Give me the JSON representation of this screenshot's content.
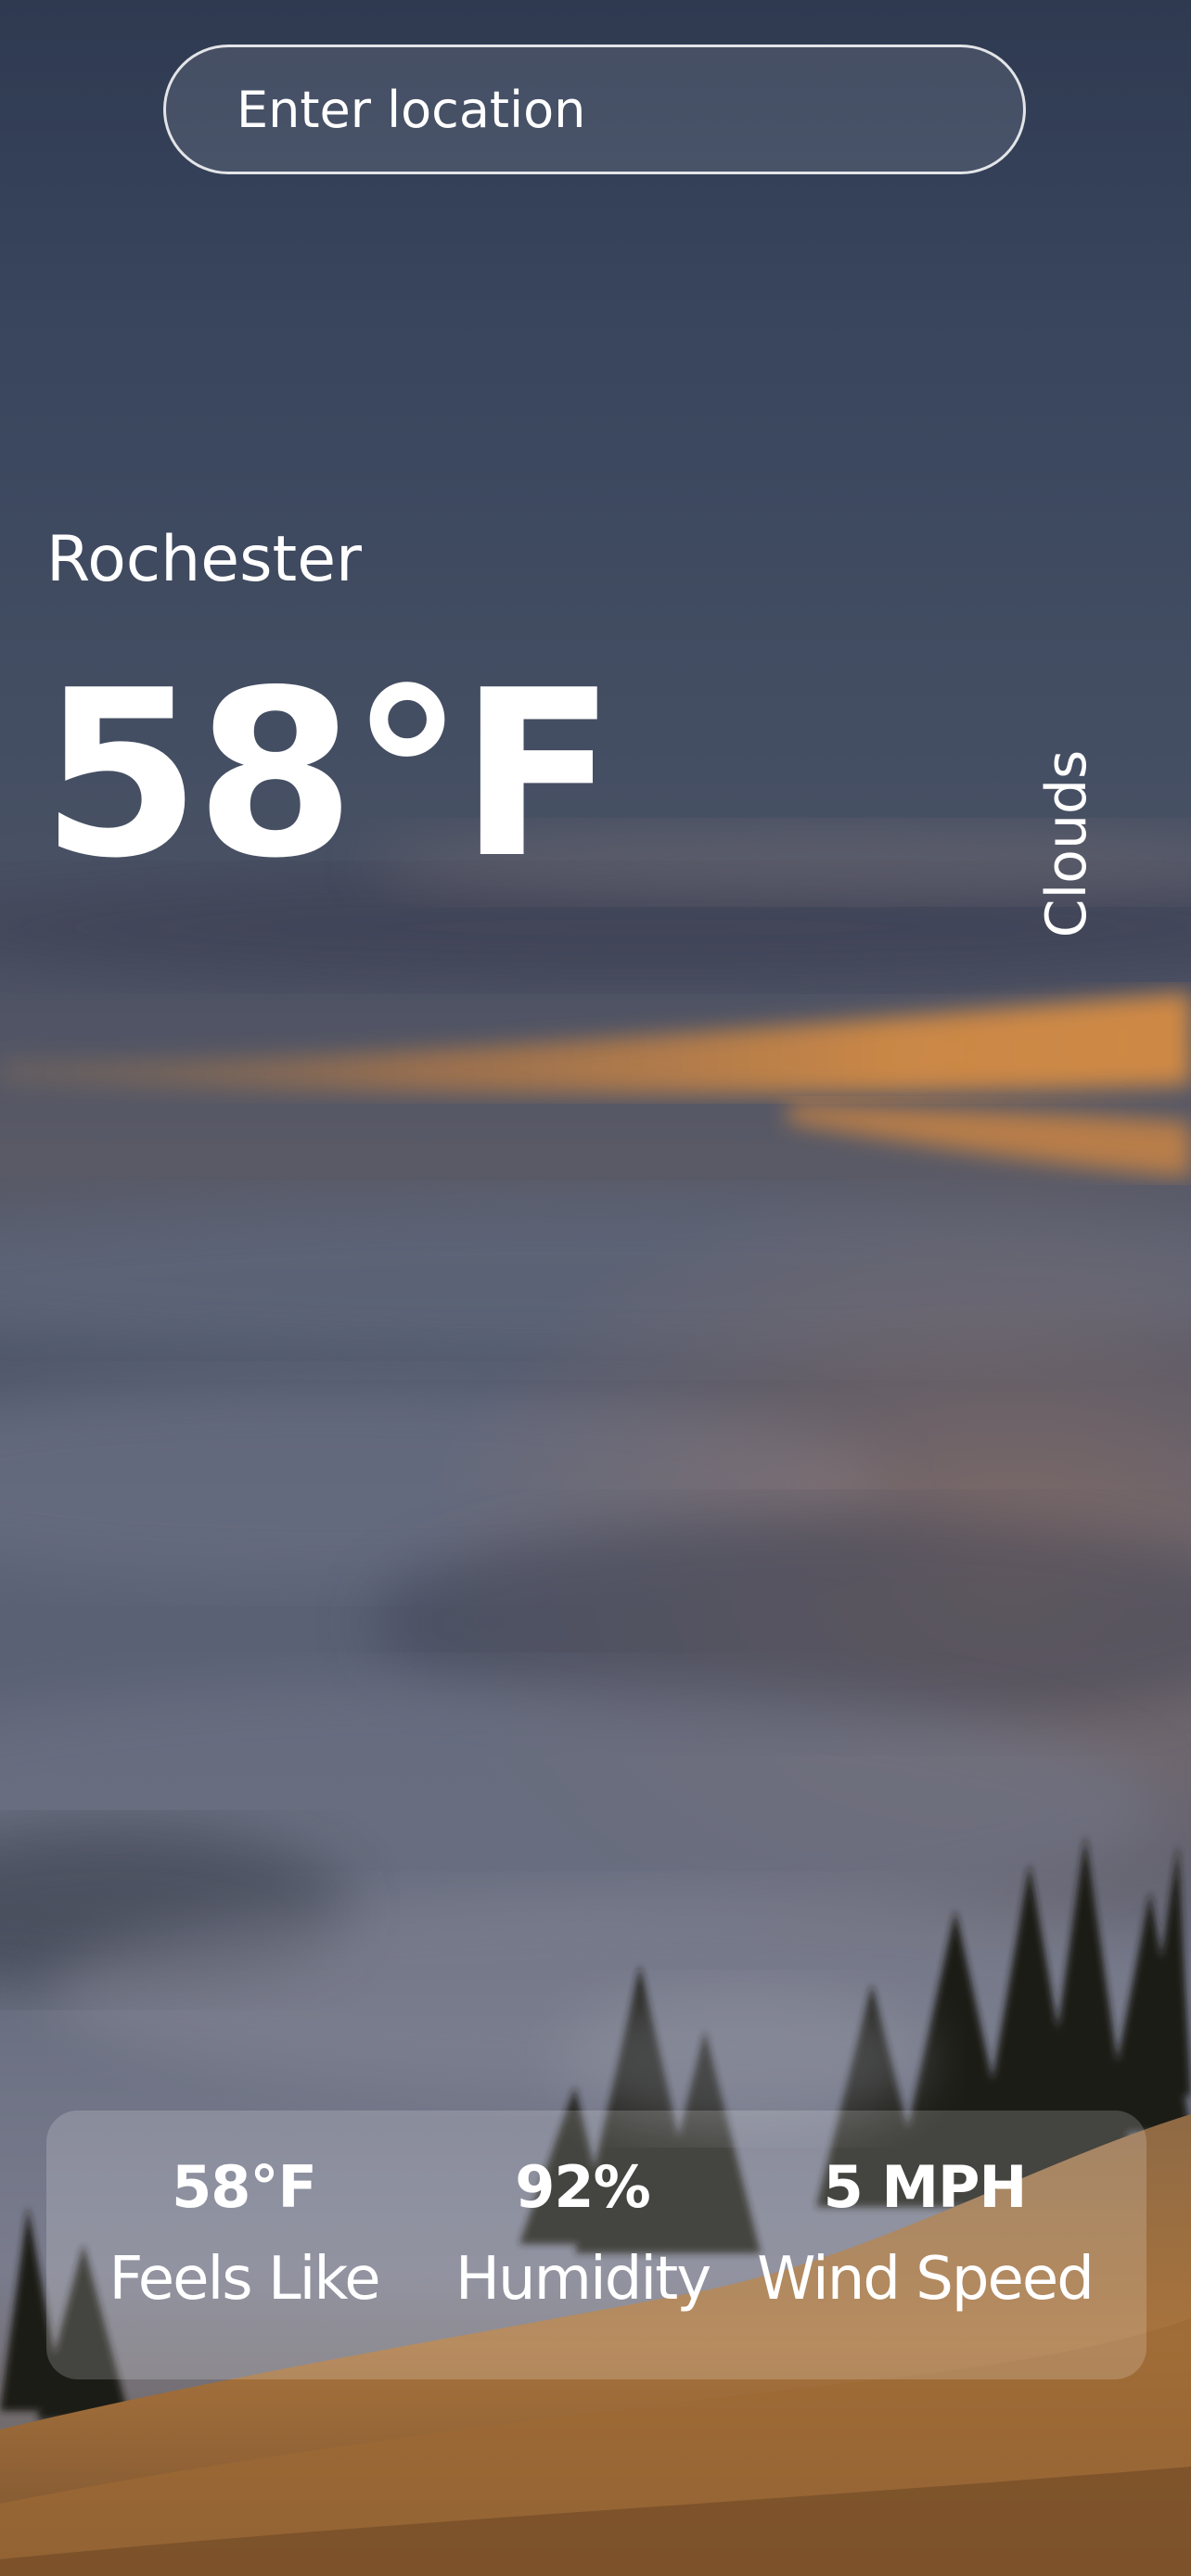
{
  "search": {
    "placeholder": "Enter location"
  },
  "weather": {
    "city": "Rochester",
    "temperature": "58°F",
    "condition": "Clouds"
  },
  "stats": [
    {
      "value": "58°F",
      "label": "Feels Like"
    },
    {
      "value": "92%",
      "label": "Humidity"
    },
    {
      "value": "5 MPH",
      "label": "Wind Speed"
    }
  ],
  "background": {
    "icon": "cloudy-mountain-sunset-photo",
    "sky_top": "#323f55",
    "sky_mid": "#4a5469",
    "sunset_band": "#c6813f",
    "fog": "#646d80",
    "hill": "#b57a39"
  }
}
